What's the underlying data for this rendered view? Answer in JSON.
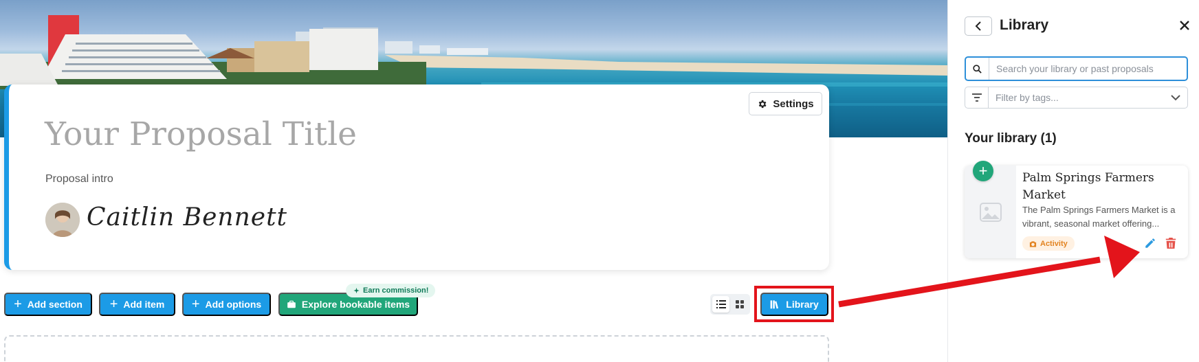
{
  "header": {
    "settings_label": "Settings"
  },
  "proposal": {
    "title": "Your Proposal Title",
    "intro": "Proposal intro",
    "signature": "Caitlin Bennett"
  },
  "toolbar": {
    "add_section": "Add section",
    "add_item": "Add item",
    "add_options": "Add options",
    "explore": "Explore bookable items",
    "earn_badge": "Earn commission!",
    "library": "Library",
    "view_modes": [
      "list",
      "grid"
    ],
    "active_view": "list"
  },
  "panel": {
    "title": "Library",
    "search_placeholder": "Search your library or past proposals",
    "filter_placeholder": "Filter by tags...",
    "section_title": "Your library (1)",
    "items": [
      {
        "title": "Palm Springs Farmers Market",
        "desc_line1": "The Palm Springs Farmers Market is a",
        "desc_line2": "vibrant, seasonal market offering...",
        "tag": "Activity",
        "tag_icon": "camera-icon"
      }
    ]
  },
  "annotation": {
    "arrow_color": "#e3141b",
    "highlight_color": "#e3141b"
  },
  "colors": {
    "accent_blue": "#1c9be6",
    "accent_green": "#21a67a",
    "delete_red": "#e5534b",
    "tag_orange": "#e2821f"
  }
}
